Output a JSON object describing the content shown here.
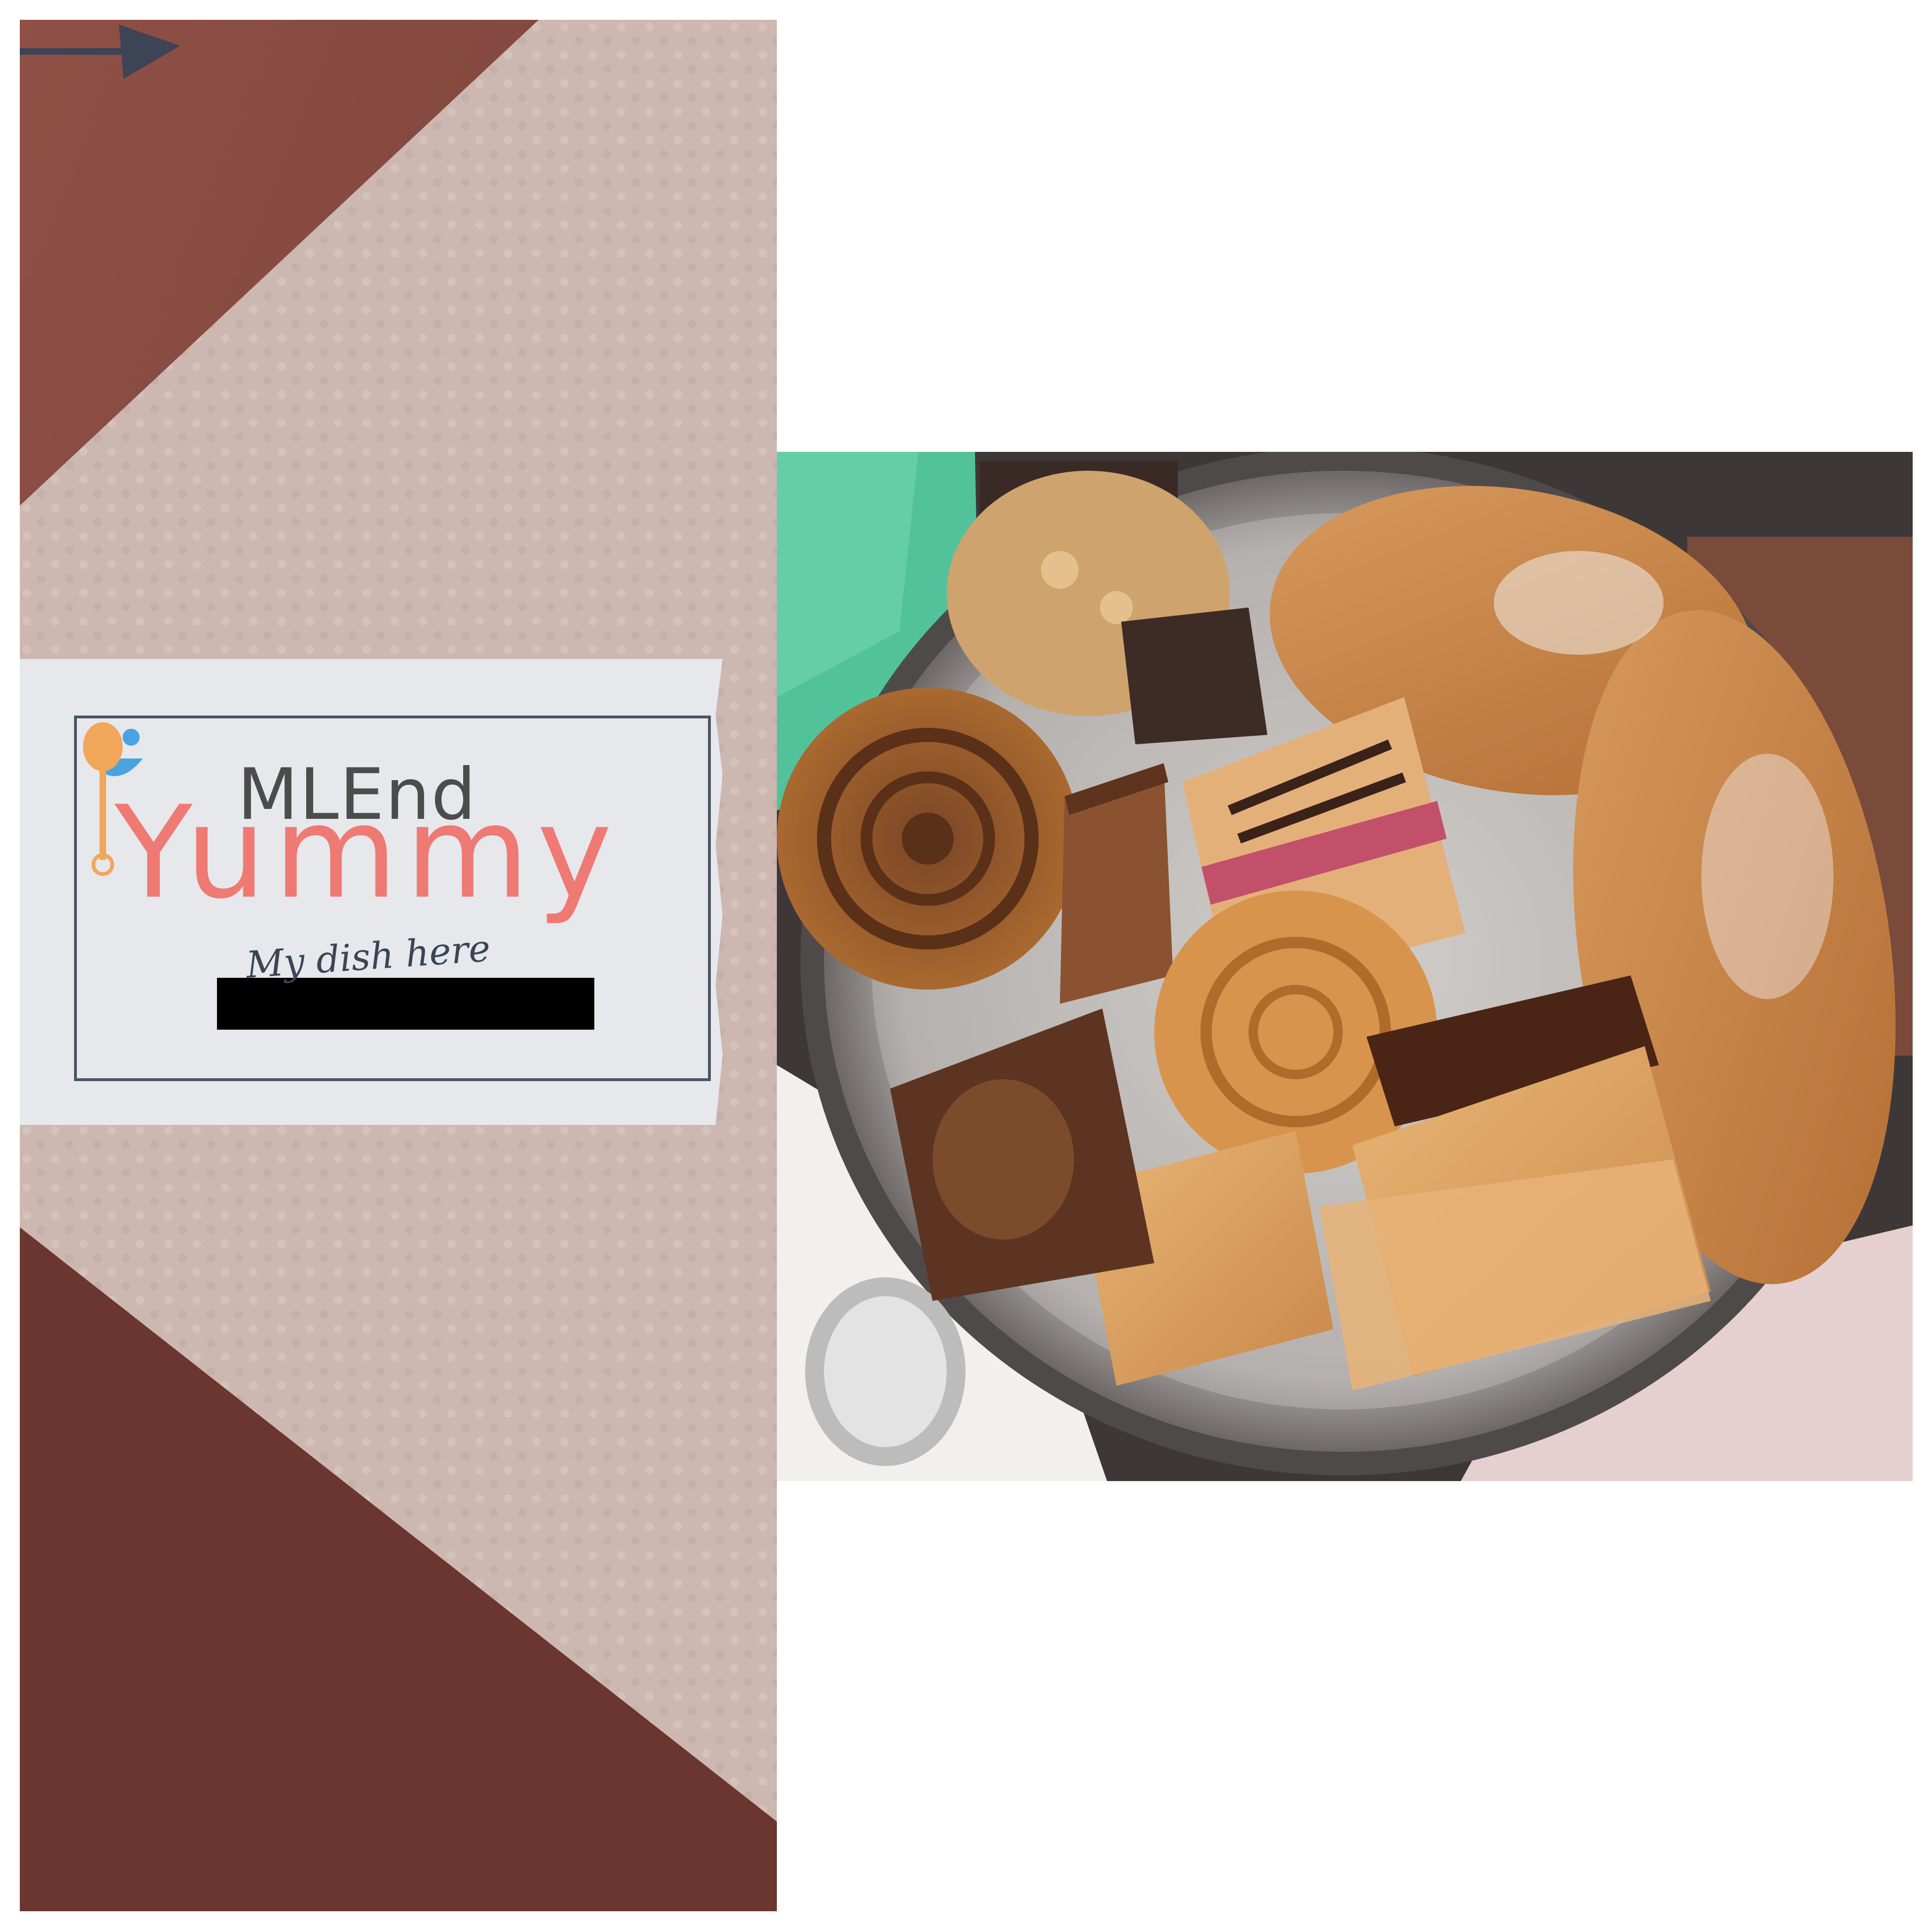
{
  "label": {
    "brand_top": "MLEnd",
    "brand_main": "Yummy",
    "caption": "My dish here"
  },
  "colors": {
    "napkin": "#cdb6b0",
    "table": "#8a4d44",
    "label_card": "#e6e8ec",
    "brand_gray": "#4c4c4c",
    "brand_coral": "#ef7a73",
    "smiley_blue": "#4aa3df",
    "spoon_orange": "#f2a65a",
    "arrow": "#3c4456",
    "tray_metal": "#b9b6b4"
  }
}
